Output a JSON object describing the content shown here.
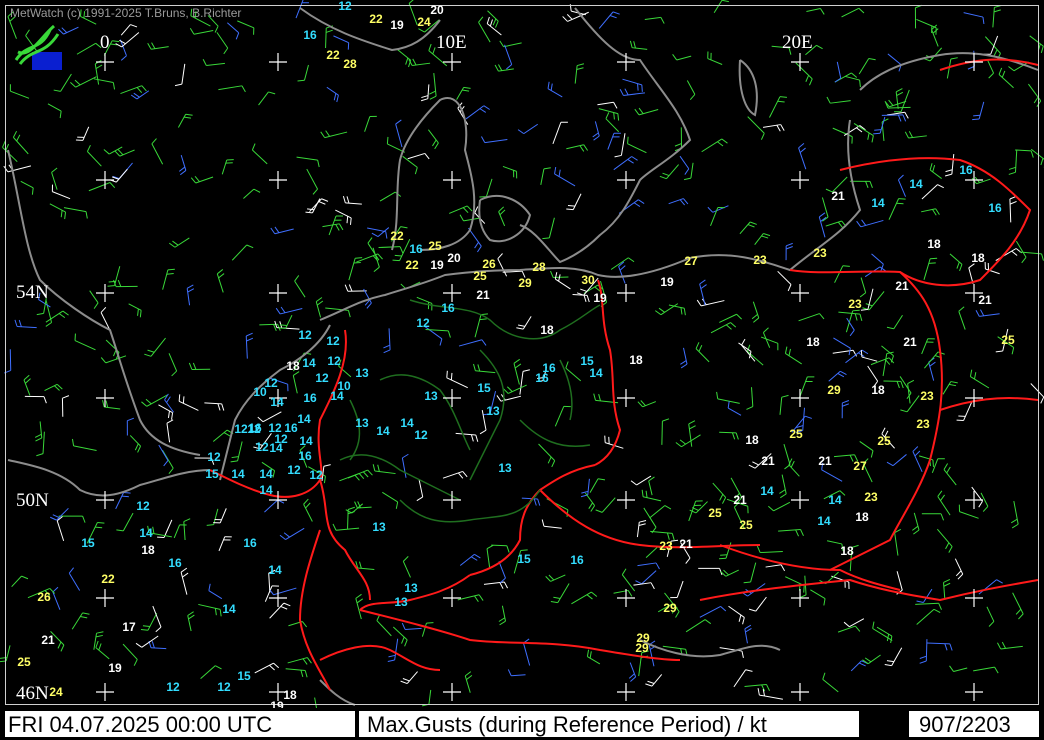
{
  "app": {
    "copyright": "MetWatch (c) 1991-2025 T.Bruns, B.Richter",
    "logo_icon": "metwatch-logo-icon"
  },
  "map": {
    "longitude_labels": [
      "0",
      "10E",
      "20E"
    ],
    "latitude_labels": [
      "54N",
      "50N",
      "46N"
    ],
    "colors": {
      "coast": "#8c8c8c",
      "border": "#ff1a1a",
      "state_border": "#1f6e1f",
      "value_white": "#ffffff",
      "value_yellow": "#ffff66",
      "value_cyan": "#33ddff",
      "barb_green": "#39d839",
      "barb_blue": "#3f6fff",
      "barb_white": "#ffffff"
    },
    "gust_values_kt": [
      {
        "v": "12",
        "c": "cyan"
      },
      {
        "v": "22",
        "c": "yellow"
      },
      {
        "v": "19",
        "c": "white"
      },
      {
        "v": "24",
        "c": "yellow"
      },
      {
        "v": "20",
        "c": "white"
      },
      {
        "v": "16",
        "c": "cyan"
      },
      {
        "v": "22",
        "c": "yellow"
      },
      {
        "v": "28",
        "c": "yellow"
      },
      {
        "v": "22",
        "c": "yellow"
      },
      {
        "v": "16",
        "c": "cyan"
      },
      {
        "v": "25",
        "c": "yellow"
      },
      {
        "v": "22",
        "c": "yellow"
      },
      {
        "v": "19",
        "c": "white"
      },
      {
        "v": "20",
        "c": "white"
      },
      {
        "v": "26",
        "c": "yellow"
      },
      {
        "v": "25",
        "c": "yellow"
      },
      {
        "v": "28",
        "c": "yellow"
      },
      {
        "v": "29",
        "c": "yellow"
      },
      {
        "v": "30",
        "c": "yellow"
      },
      {
        "v": "21",
        "c": "white"
      },
      {
        "v": "19",
        "c": "white"
      },
      {
        "v": "19",
        "c": "white"
      },
      {
        "v": "27",
        "c": "yellow"
      },
      {
        "v": "23",
        "c": "yellow"
      },
      {
        "v": "23",
        "c": "yellow"
      },
      {
        "v": "21",
        "c": "white"
      },
      {
        "v": "14",
        "c": "cyan"
      },
      {
        "v": "14",
        "c": "cyan"
      },
      {
        "v": "16",
        "c": "cyan"
      },
      {
        "v": "16",
        "c": "cyan"
      },
      {
        "v": "18",
        "c": "white"
      },
      {
        "v": "18",
        "c": "white"
      },
      {
        "v": "23",
        "c": "yellow"
      },
      {
        "v": "21",
        "c": "white"
      },
      {
        "v": "21",
        "c": "white"
      },
      {
        "v": "16",
        "c": "cyan"
      },
      {
        "v": "12",
        "c": "cyan"
      },
      {
        "v": "18",
        "c": "white"
      },
      {
        "v": "12",
        "c": "cyan"
      },
      {
        "v": "12",
        "c": "cyan"
      },
      {
        "v": "18",
        "c": "white"
      },
      {
        "v": "14",
        "c": "cyan"
      },
      {
        "v": "12",
        "c": "cyan"
      },
      {
        "v": "12",
        "c": "cyan"
      },
      {
        "v": "13",
        "c": "cyan"
      },
      {
        "v": "16",
        "c": "cyan"
      },
      {
        "v": "16",
        "c": "cyan"
      },
      {
        "v": "15",
        "c": "cyan"
      },
      {
        "v": "14",
        "c": "cyan"
      },
      {
        "v": "18",
        "c": "white"
      },
      {
        "v": "18",
        "c": "white"
      },
      {
        "v": "21",
        "c": "white"
      },
      {
        "v": "25",
        "c": "yellow"
      },
      {
        "v": "10",
        "c": "cyan"
      },
      {
        "v": "14",
        "c": "cyan"
      },
      {
        "v": "12",
        "c": "cyan"
      },
      {
        "v": "10",
        "c": "cyan"
      },
      {
        "v": "16",
        "c": "cyan"
      },
      {
        "v": "14",
        "c": "cyan"
      },
      {
        "v": "14",
        "c": "cyan"
      },
      {
        "v": "13",
        "c": "cyan"
      },
      {
        "v": "15",
        "c": "cyan"
      },
      {
        "v": "29",
        "c": "yellow"
      },
      {
        "v": "18",
        "c": "white"
      },
      {
        "v": "23",
        "c": "yellow"
      },
      {
        "v": "14",
        "c": "cyan"
      },
      {
        "v": "14",
        "c": "cyan"
      },
      {
        "v": "16",
        "c": "cyan"
      },
      {
        "v": "12",
        "c": "cyan"
      },
      {
        "v": "13",
        "c": "cyan"
      },
      {
        "v": "14",
        "c": "cyan"
      },
      {
        "v": "12",
        "c": "cyan"
      },
      {
        "v": "13",
        "c": "cyan"
      },
      {
        "v": "23",
        "c": "yellow"
      },
      {
        "v": "18",
        "c": "white"
      },
      {
        "v": "25",
        "c": "yellow"
      },
      {
        "v": "25",
        "c": "yellow"
      },
      {
        "v": "12",
        "c": "cyan"
      },
      {
        "v": "14",
        "c": "cyan"
      },
      {
        "v": "12",
        "c": "cyan"
      },
      {
        "v": "16",
        "c": "cyan"
      },
      {
        "v": "12",
        "c": "cyan"
      },
      {
        "v": "12",
        "c": "cyan"
      },
      {
        "v": "15",
        "c": "cyan"
      },
      {
        "v": "14",
        "c": "cyan"
      },
      {
        "v": "14",
        "c": "cyan"
      },
      {
        "v": "12",
        "c": "cyan"
      },
      {
        "v": "12",
        "c": "cyan"
      },
      {
        "v": "13",
        "c": "cyan"
      },
      {
        "v": "21",
        "c": "white"
      },
      {
        "v": "21",
        "c": "white"
      },
      {
        "v": "27",
        "c": "yellow"
      },
      {
        "v": "14",
        "c": "cyan"
      },
      {
        "v": "12",
        "c": "cyan"
      },
      {
        "v": "16",
        "c": "cyan"
      },
      {
        "v": "21",
        "c": "white"
      },
      {
        "v": "14",
        "c": "cyan"
      },
      {
        "v": "14",
        "c": "cyan"
      },
      {
        "v": "23",
        "c": "yellow"
      },
      {
        "v": "25",
        "c": "yellow"
      },
      {
        "v": "12",
        "c": "cyan"
      },
      {
        "v": "14",
        "c": "cyan"
      },
      {
        "v": "13",
        "c": "cyan"
      },
      {
        "v": "25",
        "c": "yellow"
      },
      {
        "v": "18",
        "c": "white"
      },
      {
        "v": "14",
        "c": "cyan"
      },
      {
        "v": "15",
        "c": "cyan"
      },
      {
        "v": "18",
        "c": "white"
      },
      {
        "v": "16",
        "c": "cyan"
      },
      {
        "v": "16",
        "c": "cyan"
      },
      {
        "v": "15",
        "c": "cyan"
      },
      {
        "v": "16",
        "c": "cyan"
      },
      {
        "v": "23",
        "c": "yellow"
      },
      {
        "v": "21",
        "c": "white"
      },
      {
        "v": "18",
        "c": "white"
      },
      {
        "v": "22",
        "c": "yellow"
      },
      {
        "v": "14",
        "c": "cyan"
      },
      {
        "v": "13",
        "c": "cyan"
      },
      {
        "v": "14",
        "c": "cyan"
      },
      {
        "v": "26",
        "c": "yellow"
      },
      {
        "v": "13",
        "c": "cyan"
      },
      {
        "v": "29",
        "c": "yellow"
      },
      {
        "v": "17",
        "c": "white"
      },
      {
        "v": "21",
        "c": "white"
      },
      {
        "v": "29",
        "c": "yellow"
      },
      {
        "v": "29",
        "c": "yellow"
      },
      {
        "v": "25",
        "c": "yellow"
      },
      {
        "v": "19",
        "c": "white"
      },
      {
        "v": "12",
        "c": "cyan"
      },
      {
        "v": "12",
        "c": "cyan"
      },
      {
        "v": "15",
        "c": "cyan"
      },
      {
        "v": "24",
        "c": "yellow"
      },
      {
        "v": "18",
        "c": "white"
      },
      {
        "v": "19",
        "c": "white"
      }
    ]
  },
  "status": {
    "datetime": "FRI 04.07.2025 00:00 UTC",
    "parameter": "Max.Gusts (during Reference Period) / kt",
    "station_count": "907/2203"
  }
}
